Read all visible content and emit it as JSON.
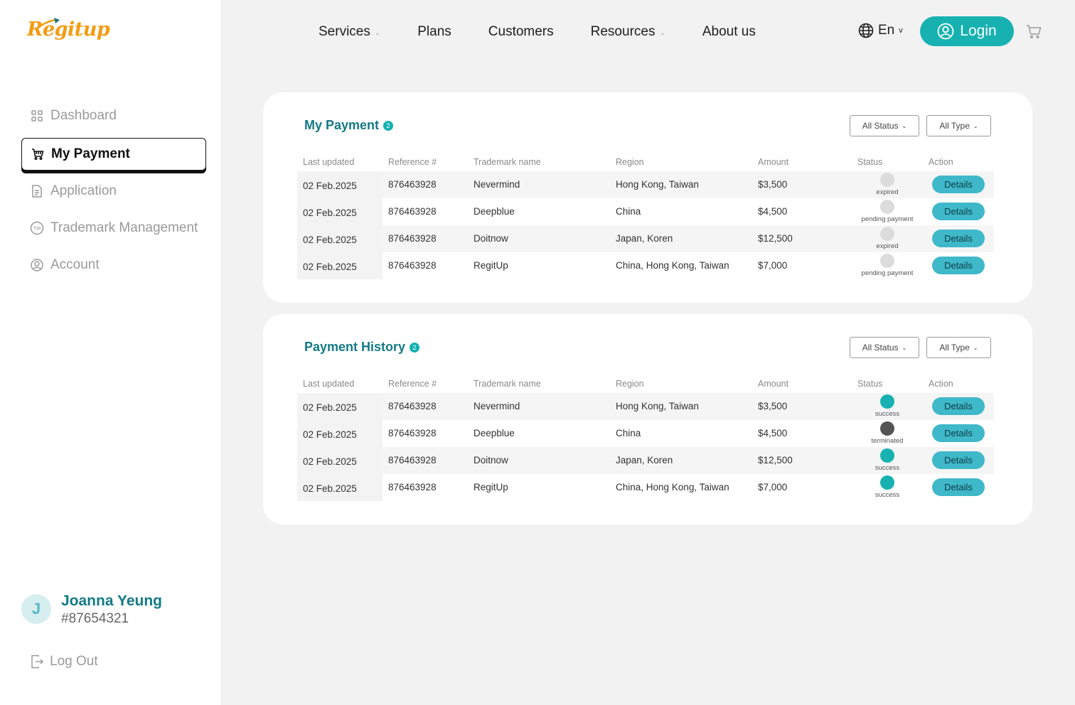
{
  "brand": {
    "logo_text": "Regitup"
  },
  "sidebar": {
    "items": [
      {
        "label": "Dashboard",
        "icon": "grid-icon"
      },
      {
        "label": "My Payment",
        "icon": "cart-icon"
      },
      {
        "label": "Application",
        "icon": "document-icon"
      },
      {
        "label": "Trademark Management",
        "icon": "tm-icon"
      },
      {
        "label": "Account",
        "icon": "user-circle-icon"
      }
    ],
    "active": "My Payment",
    "user": {
      "initial": "J",
      "name": "Joanna Yeung",
      "id": "#87654321"
    },
    "logout_label": "Log Out"
  },
  "topnav": {
    "links": [
      {
        "label": "Services",
        "dropdown": true
      },
      {
        "label": "Plans",
        "dropdown": false
      },
      {
        "label": "Customers",
        "dropdown": false
      },
      {
        "label": "Resources",
        "dropdown": true
      },
      {
        "label": "About us",
        "dropdown": false
      }
    ],
    "language": "En",
    "login_label": "Login"
  },
  "columns": [
    "Last updated",
    "Reference #",
    "Trademark name",
    "Region",
    "Amount",
    "Status",
    "Action"
  ],
  "my_payment": {
    "title": "My Payment",
    "count": "2",
    "filter_status": "All Status",
    "filter_type": "All Type",
    "rows": [
      {
        "date": "02 Feb.2025",
        "ref": "876463928",
        "name": "Nevermind",
        "region": "Hong Kong, Taiwan",
        "amount": "$3,500",
        "status": "expired",
        "status_color": "#dcdcdc",
        "action": "Details"
      },
      {
        "date": "02 Feb.2025",
        "ref": "876463928",
        "name": "Deepblue",
        "region": "China",
        "amount": "$4,500",
        "status": "pending payment",
        "status_color": "#dcdcdc",
        "action": "Details"
      },
      {
        "date": "02 Feb.2025",
        "ref": "876463928",
        "name": "Doitnow",
        "region": "Japan, Koren",
        "amount": "$12,500",
        "status": "expired",
        "status_color": "#dcdcdc",
        "action": "Details"
      },
      {
        "date": "02 Feb.2025",
        "ref": "876463928",
        "name": "RegitUp",
        "region": "China, Hong Kong, Taiwan",
        "amount": "$7,000",
        "status": "pending payment",
        "status_color": "#dcdcdc",
        "action": "Details"
      }
    ]
  },
  "payment_history": {
    "title": "Payment History",
    "count": "2",
    "filter_status": "All Status",
    "filter_type": "All Type",
    "rows": [
      {
        "date": "02 Feb.2025",
        "ref": "876463928",
        "name": "Nevermind",
        "region": "Hong Kong, Taiwan",
        "amount": "$3,500",
        "status": "success",
        "status_color": "#17b1b1",
        "action": "Details"
      },
      {
        "date": "02 Feb.2025",
        "ref": "876463928",
        "name": "Deepblue",
        "region": "China",
        "amount": "$4,500",
        "status": "terminated",
        "status_color": "#555555",
        "action": "Details"
      },
      {
        "date": "02 Feb.2025",
        "ref": "876463928",
        "name": "Doitnow",
        "region": "Japan, Koren",
        "amount": "$12,500",
        "status": "success",
        "status_color": "#17b1b1",
        "action": "Details"
      },
      {
        "date": "02 Feb.2025",
        "ref": "876463928",
        "name": "RegitUp",
        "region": "China, Hong Kong, Taiwan",
        "amount": "$7,000",
        "status": "success",
        "status_color": "#17b1b1",
        "action": "Details"
      }
    ]
  },
  "colors": {
    "accent": "#17b1b1",
    "title": "#137a85",
    "logo": "#f39c12"
  }
}
